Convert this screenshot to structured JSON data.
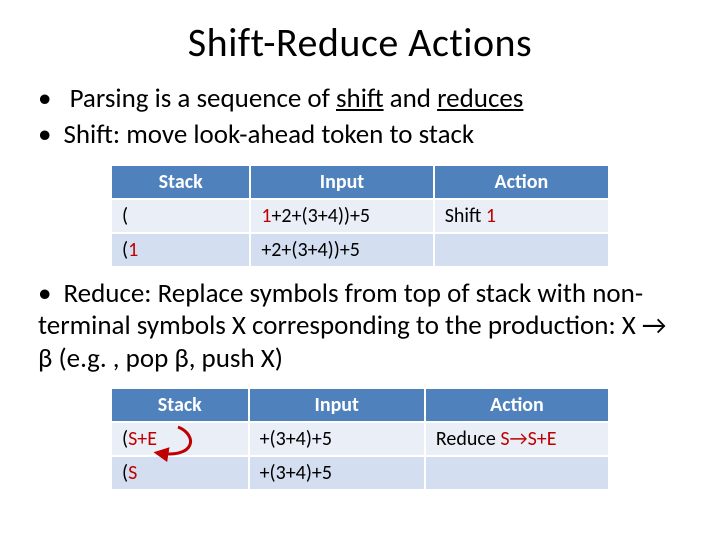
{
  "title": "Shift-Reduce Actions",
  "bullets": {
    "b1_pre": "Parsing is a sequence of ",
    "b1_u1": "shift",
    "b1_mid": " and ",
    "b1_u2": "reduces",
    "b2": "Shift: move look-ahead token to stack",
    "b3": "Reduce: Replace symbols from top of stack with non-terminal symbols X corresponding to the production: X → β (e.g. , pop β, push X)"
  },
  "table_headers": {
    "stack": "Stack",
    "input": "Input",
    "action": "Action"
  },
  "table1": {
    "rows": [
      {
        "stack": "(",
        "input_pre": "",
        "input_red": "1",
        "input_post": "+2+(3+4))+5",
        "action_pre": "Shift ",
        "action_red": "1",
        "action_post": ""
      },
      {
        "stack_pre": "(",
        "stack_red": "1",
        "input_post": "+2+(3+4))+5"
      }
    ]
  },
  "table2": {
    "rows": [
      {
        "stack_pre": "(",
        "stack_red": "S+E",
        "input": "+(3+4)+5",
        "action_pre": "Reduce  ",
        "action_red": "S→S+E"
      },
      {
        "stack_pre": "(",
        "stack_red": "S",
        "input": "+(3+4)+5"
      }
    ]
  }
}
